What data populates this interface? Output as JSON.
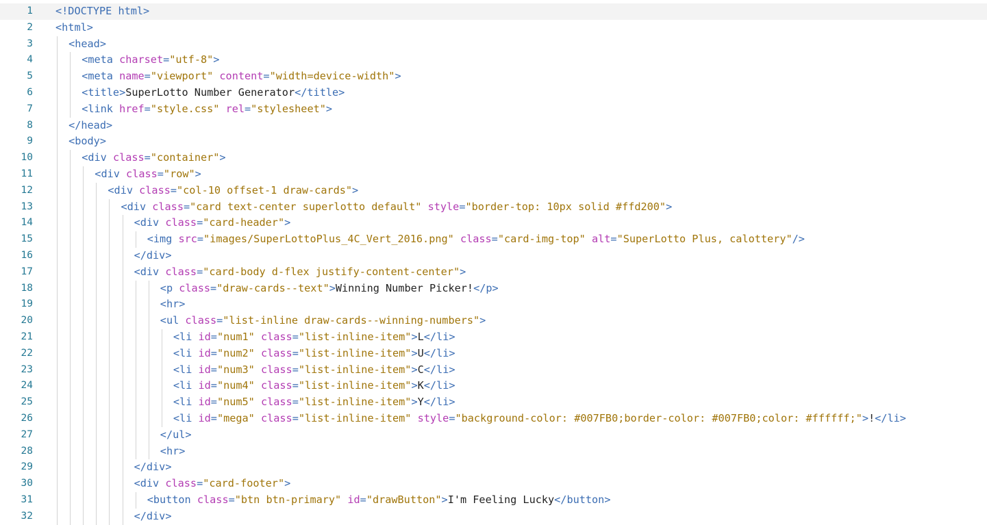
{
  "editor": {
    "current_line": 1,
    "lines": [
      {
        "n": "1",
        "indent": 0,
        "tokens": [
          [
            "p",
            "<"
          ],
          [
            "p",
            "!DOCTYPE"
          ],
          [
            "t",
            " "
          ],
          [
            "tag",
            "html"
          ],
          [
            "p",
            ">"
          ]
        ]
      },
      {
        "n": "2",
        "indent": 0,
        "tokens": [
          [
            "p",
            "<"
          ],
          [
            "tag",
            "html"
          ],
          [
            "p",
            ">"
          ]
        ]
      },
      {
        "n": "3",
        "indent": 1,
        "tokens": [
          [
            "p",
            "<"
          ],
          [
            "tag",
            "head"
          ],
          [
            "p",
            ">"
          ]
        ]
      },
      {
        "n": "4",
        "indent": 2,
        "tokens": [
          [
            "p",
            "<"
          ],
          [
            "tag",
            "meta"
          ],
          [
            "t",
            " "
          ],
          [
            "attr",
            "charset"
          ],
          [
            "p",
            "="
          ],
          [
            "str",
            "\"utf-8\""
          ],
          [
            "p",
            ">"
          ]
        ]
      },
      {
        "n": "5",
        "indent": 2,
        "tokens": [
          [
            "p",
            "<"
          ],
          [
            "tag",
            "meta"
          ],
          [
            "t",
            " "
          ],
          [
            "attr",
            "name"
          ],
          [
            "p",
            "="
          ],
          [
            "str",
            "\"viewport\""
          ],
          [
            "t",
            " "
          ],
          [
            "attr",
            "content"
          ],
          [
            "p",
            "="
          ],
          [
            "str",
            "\"width=device-width\""
          ],
          [
            "p",
            ">"
          ]
        ]
      },
      {
        "n": "6",
        "indent": 2,
        "tokens": [
          [
            "p",
            "<"
          ],
          [
            "tag",
            "title"
          ],
          [
            "p",
            ">"
          ],
          [
            "t",
            "SuperLotto Number Generator"
          ],
          [
            "p",
            "</"
          ],
          [
            "tag",
            "title"
          ],
          [
            "p",
            ">"
          ]
        ]
      },
      {
        "n": "7",
        "indent": 2,
        "tokens": [
          [
            "p",
            "<"
          ],
          [
            "tag",
            "link"
          ],
          [
            "t",
            " "
          ],
          [
            "attr",
            "href"
          ],
          [
            "p",
            "="
          ],
          [
            "str",
            "\"style.css\""
          ],
          [
            "t",
            " "
          ],
          [
            "attr",
            "rel"
          ],
          [
            "p",
            "="
          ],
          [
            "str",
            "\"stylesheet\""
          ],
          [
            "p",
            ">"
          ]
        ]
      },
      {
        "n": "8",
        "indent": 1,
        "tokens": [
          [
            "p",
            "</"
          ],
          [
            "tag",
            "head"
          ],
          [
            "p",
            ">"
          ]
        ]
      },
      {
        "n": "9",
        "indent": 1,
        "tokens": [
          [
            "p",
            "<"
          ],
          [
            "tag",
            "body"
          ],
          [
            "p",
            ">"
          ]
        ]
      },
      {
        "n": "10",
        "indent": 2,
        "tokens": [
          [
            "p",
            "<"
          ],
          [
            "tag",
            "div"
          ],
          [
            "t",
            " "
          ],
          [
            "attr",
            "class"
          ],
          [
            "p",
            "="
          ],
          [
            "str",
            "\"container\""
          ],
          [
            "p",
            ">"
          ]
        ]
      },
      {
        "n": "11",
        "indent": 3,
        "tokens": [
          [
            "p",
            "<"
          ],
          [
            "tag",
            "div"
          ],
          [
            "t",
            " "
          ],
          [
            "attr",
            "class"
          ],
          [
            "p",
            "="
          ],
          [
            "str",
            "\"row\""
          ],
          [
            "p",
            ">"
          ]
        ]
      },
      {
        "n": "12",
        "indent": 4,
        "tokens": [
          [
            "p",
            "<"
          ],
          [
            "tag",
            "div"
          ],
          [
            "t",
            " "
          ],
          [
            "attr",
            "class"
          ],
          [
            "p",
            "="
          ],
          [
            "str",
            "\"col-10 offset-1 draw-cards\""
          ],
          [
            "p",
            ">"
          ]
        ]
      },
      {
        "n": "13",
        "indent": 5,
        "tokens": [
          [
            "p",
            "<"
          ],
          [
            "tag",
            "div"
          ],
          [
            "t",
            " "
          ],
          [
            "attr",
            "class"
          ],
          [
            "p",
            "="
          ],
          [
            "str",
            "\"card text-center superlotto default\""
          ],
          [
            "t",
            " "
          ],
          [
            "attr",
            "style"
          ],
          [
            "p",
            "="
          ],
          [
            "str",
            "\"border-top: 10px solid #ffd200\""
          ],
          [
            "p",
            ">"
          ]
        ]
      },
      {
        "n": "14",
        "indent": 6,
        "tokens": [
          [
            "p",
            "<"
          ],
          [
            "tag",
            "div"
          ],
          [
            "t",
            " "
          ],
          [
            "attr",
            "class"
          ],
          [
            "p",
            "="
          ],
          [
            "str",
            "\"card-header\""
          ],
          [
            "p",
            ">"
          ]
        ]
      },
      {
        "n": "15",
        "indent": 7,
        "tokens": [
          [
            "p",
            "<"
          ],
          [
            "tag",
            "img"
          ],
          [
            "t",
            " "
          ],
          [
            "attr",
            "src"
          ],
          [
            "p",
            "="
          ],
          [
            "str",
            "\"images/SuperLottoPlus_4C_Vert_2016.png\""
          ],
          [
            "t",
            " "
          ],
          [
            "attr",
            "class"
          ],
          [
            "p",
            "="
          ],
          [
            "str",
            "\"card-img-top\""
          ],
          [
            "t",
            " "
          ],
          [
            "attr",
            "alt"
          ],
          [
            "p",
            "="
          ],
          [
            "str",
            "\"SuperLotto Plus, calottery\""
          ],
          [
            "p",
            "/>"
          ]
        ]
      },
      {
        "n": "16",
        "indent": 6,
        "tokens": [
          [
            "p",
            "</"
          ],
          [
            "tag",
            "div"
          ],
          [
            "p",
            ">"
          ]
        ]
      },
      {
        "n": "17",
        "indent": 6,
        "tokens": [
          [
            "p",
            "<"
          ],
          [
            "tag",
            "div"
          ],
          [
            "t",
            " "
          ],
          [
            "attr",
            "class"
          ],
          [
            "p",
            "="
          ],
          [
            "str",
            "\"card-body d-flex justify-content-center\""
          ],
          [
            "p",
            ">"
          ]
        ]
      },
      {
        "n": "18",
        "indent": 8,
        "tokens": [
          [
            "p",
            "<"
          ],
          [
            "tag",
            "p"
          ],
          [
            "t",
            " "
          ],
          [
            "attr",
            "class"
          ],
          [
            "p",
            "="
          ],
          [
            "str",
            "\"draw-cards--text\""
          ],
          [
            "p",
            ">"
          ],
          [
            "t",
            "Winning Number Picker!"
          ],
          [
            "p",
            "</"
          ],
          [
            "tag",
            "p"
          ],
          [
            "p",
            ">"
          ]
        ]
      },
      {
        "n": "19",
        "indent": 8,
        "tokens": [
          [
            "p",
            "<"
          ],
          [
            "tag",
            "hr"
          ],
          [
            "p",
            ">"
          ]
        ]
      },
      {
        "n": "20",
        "indent": 8,
        "tokens": [
          [
            "p",
            "<"
          ],
          [
            "tag",
            "ul"
          ],
          [
            "t",
            " "
          ],
          [
            "attr",
            "class"
          ],
          [
            "p",
            "="
          ],
          [
            "str",
            "\"list-inline draw-cards--winning-numbers\""
          ],
          [
            "p",
            ">"
          ]
        ]
      },
      {
        "n": "21",
        "indent": 9,
        "tokens": [
          [
            "p",
            "<"
          ],
          [
            "tag",
            "li"
          ],
          [
            "t",
            " "
          ],
          [
            "attr",
            "id"
          ],
          [
            "p",
            "="
          ],
          [
            "str",
            "\"num1\""
          ],
          [
            "t",
            " "
          ],
          [
            "attr",
            "class"
          ],
          [
            "p",
            "="
          ],
          [
            "str",
            "\"list-inline-item\""
          ],
          [
            "p",
            ">"
          ],
          [
            "t",
            "L"
          ],
          [
            "p",
            "</"
          ],
          [
            "tag",
            "li"
          ],
          [
            "p",
            ">"
          ]
        ]
      },
      {
        "n": "22",
        "indent": 9,
        "tokens": [
          [
            "p",
            "<"
          ],
          [
            "tag",
            "li"
          ],
          [
            "t",
            " "
          ],
          [
            "attr",
            "id"
          ],
          [
            "p",
            "="
          ],
          [
            "str",
            "\"num2\""
          ],
          [
            "t",
            " "
          ],
          [
            "attr",
            "class"
          ],
          [
            "p",
            "="
          ],
          [
            "str",
            "\"list-inline-item\""
          ],
          [
            "p",
            ">"
          ],
          [
            "t",
            "U"
          ],
          [
            "p",
            "</"
          ],
          [
            "tag",
            "li"
          ],
          [
            "p",
            ">"
          ]
        ]
      },
      {
        "n": "23",
        "indent": 9,
        "tokens": [
          [
            "p",
            "<"
          ],
          [
            "tag",
            "li"
          ],
          [
            "t",
            " "
          ],
          [
            "attr",
            "id"
          ],
          [
            "p",
            "="
          ],
          [
            "str",
            "\"num3\""
          ],
          [
            "t",
            " "
          ],
          [
            "attr",
            "class"
          ],
          [
            "p",
            "="
          ],
          [
            "str",
            "\"list-inline-item\""
          ],
          [
            "p",
            ">"
          ],
          [
            "t",
            "C"
          ],
          [
            "p",
            "</"
          ],
          [
            "tag",
            "li"
          ],
          [
            "p",
            ">"
          ]
        ]
      },
      {
        "n": "24",
        "indent": 9,
        "tokens": [
          [
            "p",
            "<"
          ],
          [
            "tag",
            "li"
          ],
          [
            "t",
            " "
          ],
          [
            "attr",
            "id"
          ],
          [
            "p",
            "="
          ],
          [
            "str",
            "\"num4\""
          ],
          [
            "t",
            " "
          ],
          [
            "attr",
            "class"
          ],
          [
            "p",
            "="
          ],
          [
            "str",
            "\"list-inline-item\""
          ],
          [
            "p",
            ">"
          ],
          [
            "t",
            "K"
          ],
          [
            "p",
            "</"
          ],
          [
            "tag",
            "li"
          ],
          [
            "p",
            ">"
          ]
        ]
      },
      {
        "n": "25",
        "indent": 9,
        "tokens": [
          [
            "p",
            "<"
          ],
          [
            "tag",
            "li"
          ],
          [
            "t",
            " "
          ],
          [
            "attr",
            "id"
          ],
          [
            "p",
            "="
          ],
          [
            "str",
            "\"num5\""
          ],
          [
            "t",
            " "
          ],
          [
            "attr",
            "class"
          ],
          [
            "p",
            "="
          ],
          [
            "str",
            "\"list-inline-item\""
          ],
          [
            "p",
            ">"
          ],
          [
            "t",
            "Y"
          ],
          [
            "p",
            "</"
          ],
          [
            "tag",
            "li"
          ],
          [
            "p",
            ">"
          ]
        ]
      },
      {
        "n": "26",
        "indent": 9,
        "tokens": [
          [
            "p",
            "<"
          ],
          [
            "tag",
            "li"
          ],
          [
            "t",
            " "
          ],
          [
            "attr",
            "id"
          ],
          [
            "p",
            "="
          ],
          [
            "str",
            "\"mega\""
          ],
          [
            "t",
            " "
          ],
          [
            "attr",
            "class"
          ],
          [
            "p",
            "="
          ],
          [
            "str",
            "\"list-inline-item\""
          ],
          [
            "t",
            " "
          ],
          [
            "attr",
            "style"
          ],
          [
            "p",
            "="
          ],
          [
            "str",
            "\"background-color: #007FB0;border-color: #007FB0;color: #ffffff;\""
          ],
          [
            "p",
            ">"
          ],
          [
            "t",
            "!"
          ],
          [
            "p",
            "</"
          ],
          [
            "tag",
            "li"
          ],
          [
            "p",
            ">"
          ]
        ]
      },
      {
        "n": "27",
        "indent": 8,
        "tokens": [
          [
            "p",
            "</"
          ],
          [
            "tag",
            "ul"
          ],
          [
            "p",
            ">"
          ]
        ]
      },
      {
        "n": "28",
        "indent": 8,
        "tokens": [
          [
            "p",
            "<"
          ],
          [
            "tag",
            "hr"
          ],
          [
            "p",
            ">"
          ]
        ]
      },
      {
        "n": "29",
        "indent": 6,
        "tokens": [
          [
            "p",
            "</"
          ],
          [
            "tag",
            "div"
          ],
          [
            "p",
            ">"
          ]
        ]
      },
      {
        "n": "30",
        "indent": 6,
        "tokens": [
          [
            "p",
            "<"
          ],
          [
            "tag",
            "div"
          ],
          [
            "t",
            " "
          ],
          [
            "attr",
            "class"
          ],
          [
            "p",
            "="
          ],
          [
            "str",
            "\"card-footer\""
          ],
          [
            "p",
            ">"
          ]
        ]
      },
      {
        "n": "31",
        "indent": 7,
        "tokens": [
          [
            "p",
            "<"
          ],
          [
            "tag",
            "button"
          ],
          [
            "t",
            " "
          ],
          [
            "attr",
            "class"
          ],
          [
            "p",
            "="
          ],
          [
            "str",
            "\"btn btn-primary\""
          ],
          [
            "t",
            " "
          ],
          [
            "attr",
            "id"
          ],
          [
            "p",
            "="
          ],
          [
            "str",
            "\"drawButton\""
          ],
          [
            "p",
            ">"
          ],
          [
            "t",
            "I'm Feeling Lucky"
          ],
          [
            "p",
            "</"
          ],
          [
            "tag",
            "button"
          ],
          [
            "p",
            ">"
          ]
        ]
      },
      {
        "n": "32",
        "indent": 6,
        "tokens": [
          [
            "p",
            "</"
          ],
          [
            "tag",
            "div"
          ],
          [
            "p",
            ">"
          ]
        ]
      }
    ]
  },
  "colors": {
    "tag": "#3b6db3",
    "attr": "#b33cb3",
    "str": "#a0750a",
    "punc": "#3b6db3",
    "text": "#222222",
    "line_number": "#237893",
    "current_line_bg": "#f3f3f3",
    "indent_guide": "#d3d3d3"
  }
}
